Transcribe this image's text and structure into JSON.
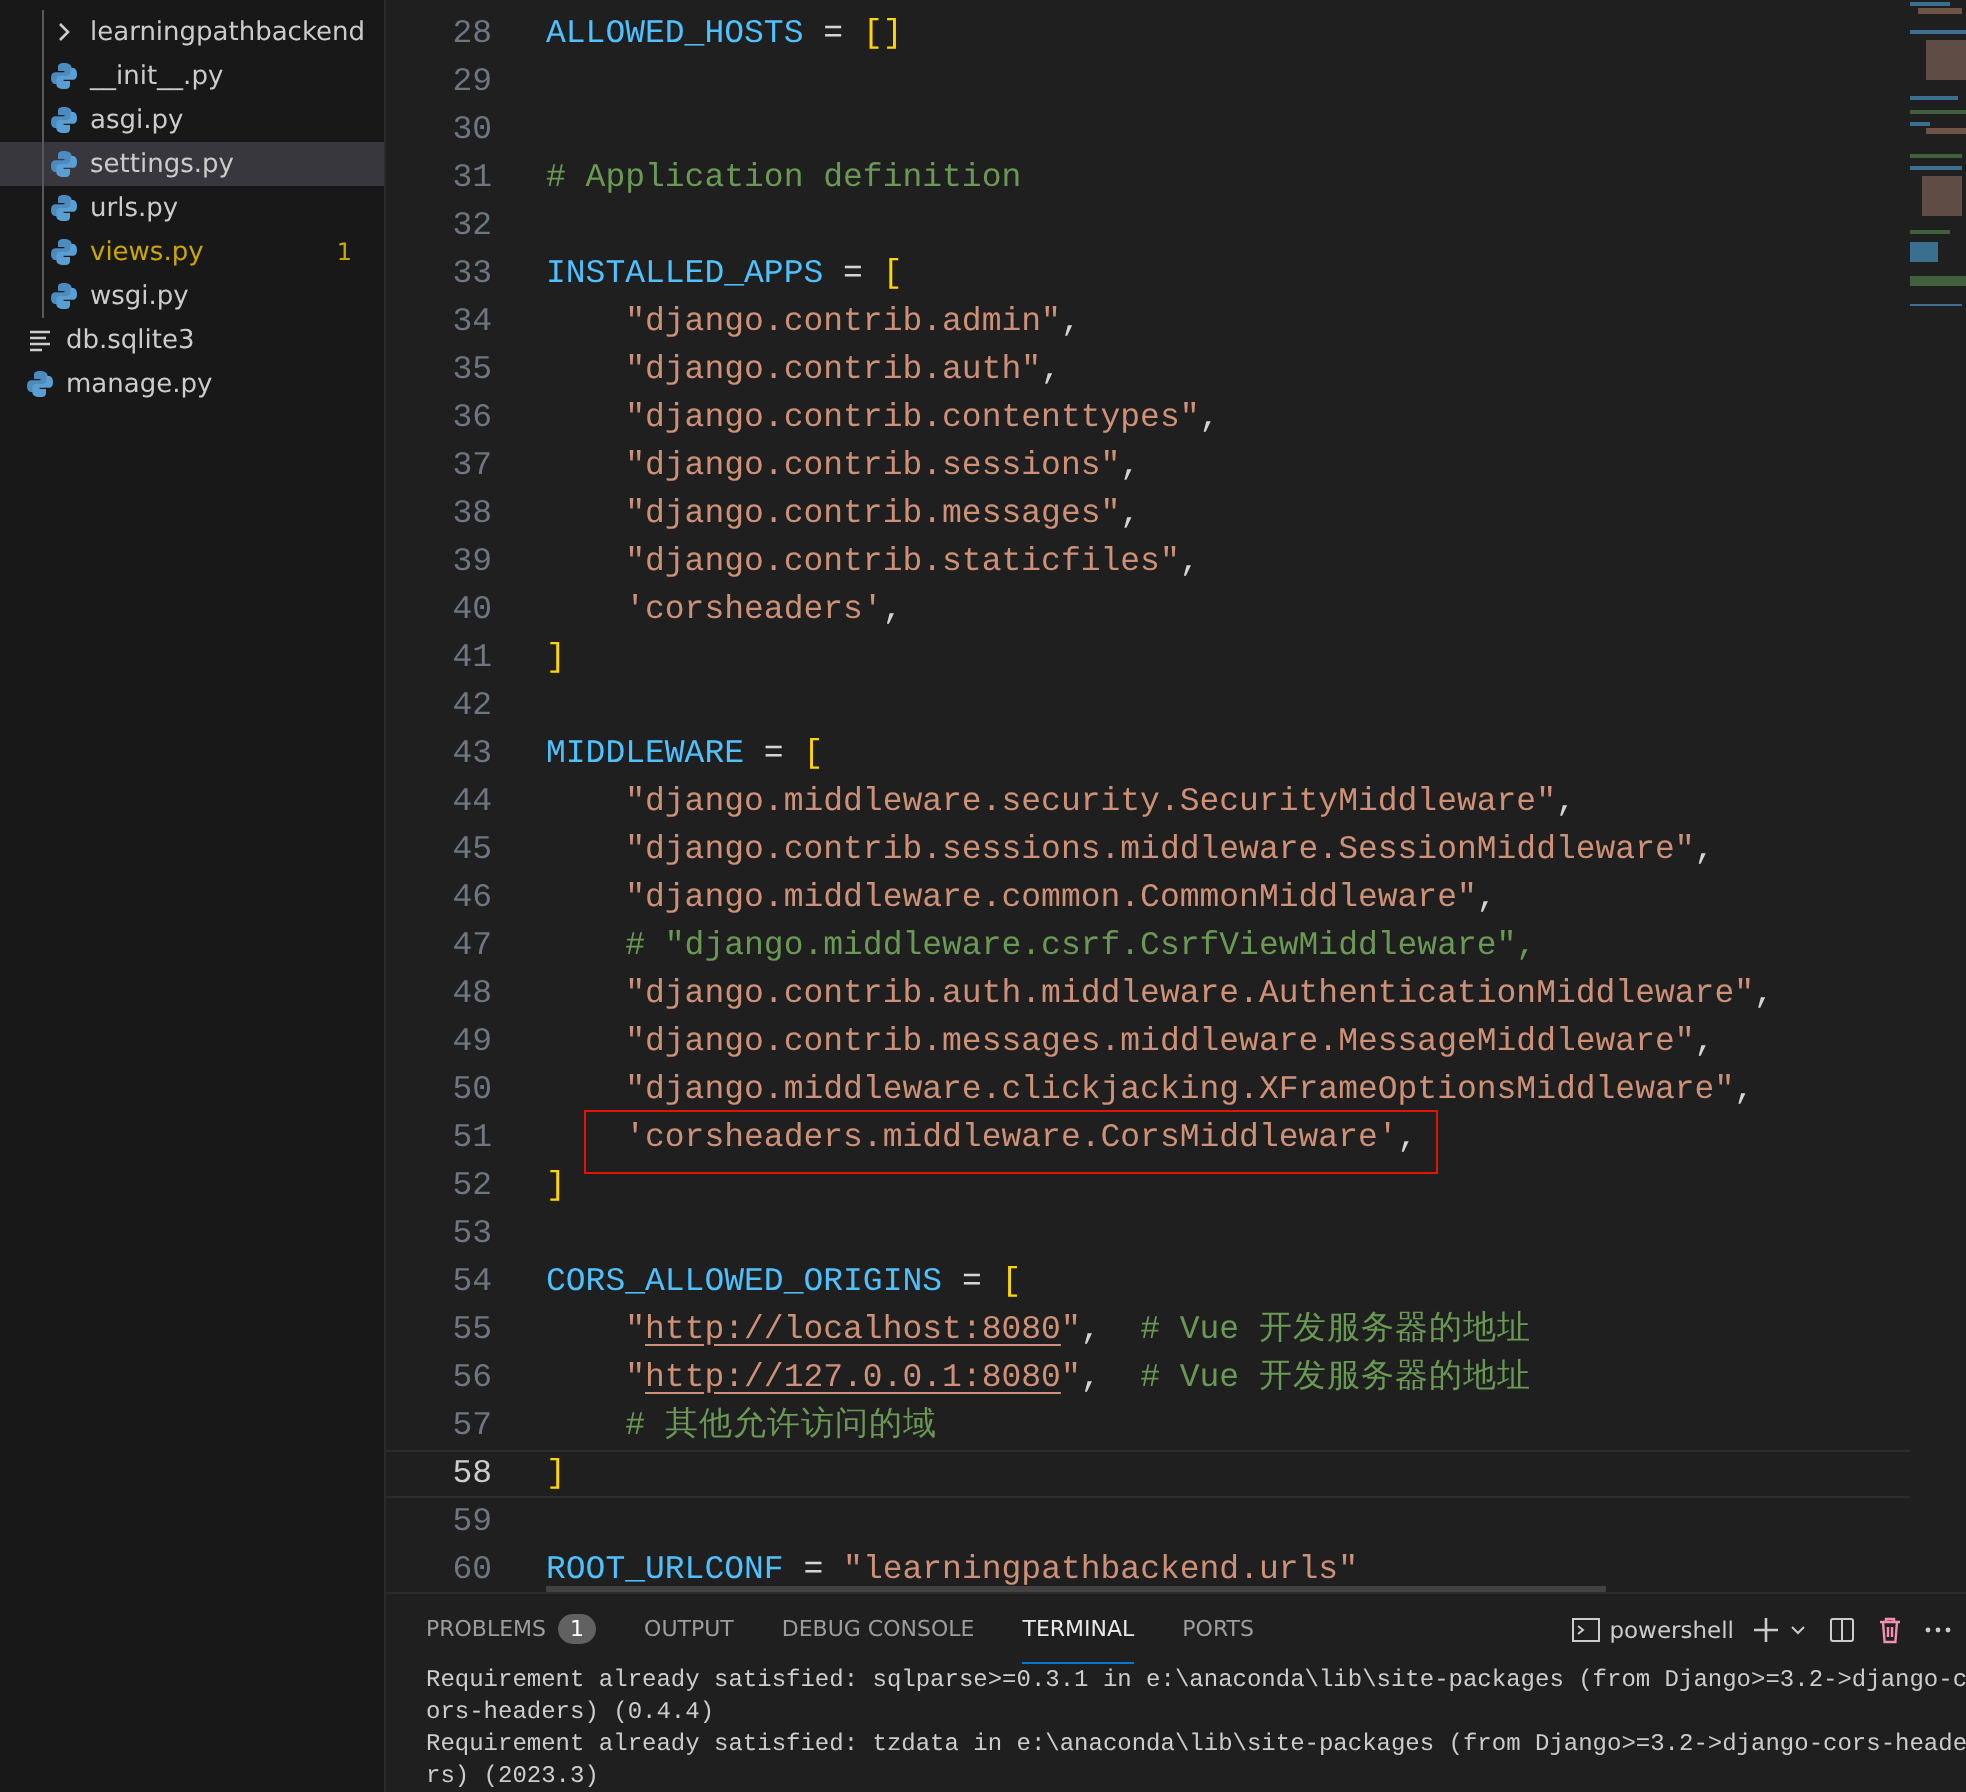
{
  "sidebar": {
    "subfolder_items": [
      {
        "name": "learningpathbackend",
        "kind": "folder",
        "expanded": false,
        "selected": false,
        "warning": false
      },
      {
        "name": "__init__.py",
        "kind": "python",
        "selected": false,
        "warning": false
      },
      {
        "name": "asgi.py",
        "kind": "python",
        "selected": false,
        "warning": false
      },
      {
        "name": "settings.py",
        "kind": "python",
        "selected": true,
        "warning": false
      },
      {
        "name": "urls.py",
        "kind": "python",
        "selected": false,
        "warning": false
      },
      {
        "name": "views.py",
        "kind": "python",
        "selected": false,
        "warning": true,
        "badge": "1"
      },
      {
        "name": "wsgi.py",
        "kind": "python",
        "selected": false,
        "warning": false
      }
    ],
    "root_items": [
      {
        "name": "db.sqlite3",
        "kind": "database",
        "selected": false,
        "warning": false
      },
      {
        "name": "manage.py",
        "kind": "python",
        "selected": false,
        "warning": false
      }
    ]
  },
  "editor": {
    "lines": [
      {
        "n": "28",
        "current": false,
        "highlighted": false,
        "tokens": [
          {
            "kind": "var",
            "text": "ALLOWED_HOSTS"
          },
          {
            "kind": "op",
            "text": " = "
          },
          {
            "kind": "bracket",
            "text": "[]"
          }
        ]
      },
      {
        "n": "29",
        "current": false,
        "highlighted": false
      },
      {
        "n": "30",
        "current": false,
        "highlighted": false
      },
      {
        "n": "31",
        "current": false,
        "highlighted": false,
        "tokens": [
          {
            "kind": "comment",
            "text": "# Application definition"
          }
        ]
      },
      {
        "n": "32",
        "current": false,
        "highlighted": false
      },
      {
        "n": "33",
        "current": false,
        "highlighted": false,
        "tokens": [
          {
            "kind": "var",
            "text": "INSTALLED_APPS"
          },
          {
            "kind": "op",
            "text": " = "
          },
          {
            "kind": "bracket",
            "text": "["
          }
        ]
      },
      {
        "n": "34",
        "current": false,
        "highlighted": false,
        "tokens": [
          {
            "kind": "str",
            "text": "    \"django.contrib.admin\""
          },
          {
            "kind": "op",
            "text": ","
          }
        ]
      },
      {
        "n": "35",
        "current": false,
        "highlighted": false,
        "tokens": [
          {
            "kind": "str",
            "text": "    \"django.contrib.auth\""
          },
          {
            "kind": "op",
            "text": ","
          }
        ]
      },
      {
        "n": "36",
        "current": false,
        "highlighted": false,
        "tokens": [
          {
            "kind": "str",
            "text": "    \"django.contrib.contenttypes\""
          },
          {
            "kind": "op",
            "text": ","
          }
        ]
      },
      {
        "n": "37",
        "current": false,
        "highlighted": false,
        "tokens": [
          {
            "kind": "str",
            "text": "    \"django.contrib.sessions\""
          },
          {
            "kind": "op",
            "text": ","
          }
        ]
      },
      {
        "n": "38",
        "current": false,
        "highlighted": false,
        "tokens": [
          {
            "kind": "str",
            "text": "    \"django.contrib.messages\""
          },
          {
            "kind": "op",
            "text": ","
          }
        ]
      },
      {
        "n": "39",
        "current": false,
        "highlighted": false,
        "tokens": [
          {
            "kind": "str",
            "text": "    \"django.contrib.staticfiles\""
          },
          {
            "kind": "op",
            "text": ","
          }
        ]
      },
      {
        "n": "40",
        "current": false,
        "highlighted": false,
        "tokens": [
          {
            "kind": "str",
            "text": "    'corsheaders'"
          },
          {
            "kind": "op",
            "text": ","
          }
        ]
      },
      {
        "n": "41",
        "current": false,
        "highlighted": false,
        "tokens": [
          {
            "kind": "bracket",
            "text": "]"
          }
        ]
      },
      {
        "n": "42",
        "current": false,
        "highlighted": false
      },
      {
        "n": "43",
        "current": false,
        "highlighted": false,
        "tokens": [
          {
            "kind": "var",
            "text": "MIDDLEWARE"
          },
          {
            "kind": "op",
            "text": " = "
          },
          {
            "kind": "bracket",
            "text": "["
          }
        ]
      },
      {
        "n": "44",
        "current": false,
        "highlighted": false,
        "tokens": [
          {
            "kind": "str",
            "text": "    \"django.middleware.security.SecurityMiddleware\""
          },
          {
            "kind": "op",
            "text": ","
          }
        ]
      },
      {
        "n": "45",
        "current": false,
        "highlighted": false,
        "tokens": [
          {
            "kind": "str",
            "text": "    \"django.contrib.sessions.middleware.SessionMiddleware\""
          },
          {
            "kind": "op",
            "text": ","
          }
        ]
      },
      {
        "n": "46",
        "current": false,
        "highlighted": false,
        "tokens": [
          {
            "kind": "str",
            "text": "    \"django.middleware.common.CommonMiddleware\""
          },
          {
            "kind": "op",
            "text": ","
          }
        ]
      },
      {
        "n": "47",
        "current": false,
        "highlighted": false,
        "tokens": [
          {
            "kind": "comment",
            "text": "    # \"django.middleware.csrf.CsrfViewMiddleware\","
          }
        ]
      },
      {
        "n": "48",
        "current": false,
        "highlighted": false,
        "tokens": [
          {
            "kind": "str",
            "text": "    \"django.contrib.auth.middleware.AuthenticationMiddleware\""
          },
          {
            "kind": "op",
            "text": ","
          }
        ]
      },
      {
        "n": "49",
        "current": false,
        "highlighted": false,
        "tokens": [
          {
            "kind": "str",
            "text": "    \"django.contrib.messages.middleware.MessageMiddleware\""
          },
          {
            "kind": "op",
            "text": ","
          }
        ]
      },
      {
        "n": "50",
        "current": false,
        "highlighted": false,
        "tokens": [
          {
            "kind": "str",
            "text": "    \"django.middleware.clickjacking.XFrameOptionsMiddleware\""
          },
          {
            "kind": "op",
            "text": ","
          }
        ]
      },
      {
        "n": "51",
        "current": false,
        "highlighted": true,
        "tokens": [
          {
            "kind": "str",
            "text": "    'corsheaders.middleware.CorsMiddleware'"
          },
          {
            "kind": "op",
            "text": ","
          }
        ]
      },
      {
        "n": "52",
        "current": false,
        "highlighted": false,
        "tokens": [
          {
            "kind": "bracket",
            "text": "]"
          }
        ]
      },
      {
        "n": "53",
        "current": false,
        "highlighted": false
      },
      {
        "n": "54",
        "current": false,
        "highlighted": false,
        "tokens": [
          {
            "kind": "var",
            "text": "CORS_ALLOWED_ORIGINS"
          },
          {
            "kind": "op",
            "text": " = "
          },
          {
            "kind": "bracket",
            "text": "["
          }
        ]
      },
      {
        "n": "55",
        "current": false,
        "highlighted": false,
        "tokens": [
          {
            "kind": "str",
            "text": "    \""
          },
          {
            "kind": "url",
            "text": "http://localhost:8080"
          },
          {
            "kind": "str",
            "text": "\""
          },
          {
            "kind": "op",
            "text": ",  "
          },
          {
            "kind": "comment",
            "text": "# Vue 开发服务器的地址"
          }
        ]
      },
      {
        "n": "56",
        "current": false,
        "highlighted": false,
        "tokens": [
          {
            "kind": "str",
            "text": "    \""
          },
          {
            "kind": "url",
            "text": "http://127.0.0.1:8080"
          },
          {
            "kind": "str",
            "text": "\""
          },
          {
            "kind": "op",
            "text": ",  "
          },
          {
            "kind": "comment",
            "text": "# Vue 开发服务器的地址"
          }
        ]
      },
      {
        "n": "57",
        "current": false,
        "highlighted": false,
        "tokens": [
          {
            "kind": "comment",
            "text": "    # 其他允许访问的域"
          }
        ]
      },
      {
        "n": "58",
        "current": true,
        "highlighted": false,
        "tokens": [
          {
            "kind": "bracket",
            "text": "]"
          }
        ]
      },
      {
        "n": "59",
        "current": false,
        "highlighted": false
      },
      {
        "n": "60",
        "current": false,
        "highlighted": false,
        "tokens": [
          {
            "kind": "var",
            "text": "ROOT_URLCONF"
          },
          {
            "kind": "op",
            "text": " = "
          },
          {
            "kind": "str",
            "text": "\"learningpathbackend.urls\""
          }
        ]
      }
    ]
  },
  "panel": {
    "tabs": [
      {
        "label": "PROBLEMS",
        "selected": false,
        "badge": "1"
      },
      {
        "label": "OUTPUT",
        "selected": false
      },
      {
        "label": "DEBUG CONSOLE",
        "selected": false
      },
      {
        "label": "TERMINAL",
        "selected": true
      },
      {
        "label": "PORTS",
        "selected": false
      }
    ],
    "shell": "powershell",
    "terminal_lines": [
      "Requirement already satisfied: sqlparse>=0.3.1 in e:\\anaconda\\lib\\site-packages (from Django>=3.2->django-c",
      "ors-headers) (0.4.4)",
      "Requirement already satisfied: tzdata in e:\\anaconda\\lib\\site-packages (from Django>=3.2->django-cors-heade",
      "rs) (2023.3)"
    ]
  }
}
